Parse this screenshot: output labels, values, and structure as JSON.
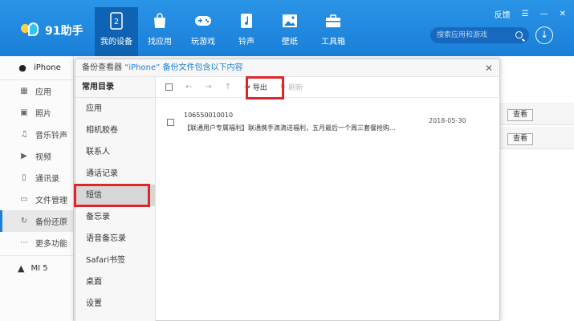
{
  "app": {
    "logo_text": "91助手",
    "window_controls": {
      "feedback": "反馈",
      "menu": "☰",
      "minimize": "—",
      "close": "✕"
    },
    "search": {
      "placeholder": "搜索应用和游戏"
    }
  },
  "nav": [
    {
      "label": "我的设备",
      "icon": "device-icon",
      "active": true
    },
    {
      "label": "找应用",
      "icon": "bag-icon"
    },
    {
      "label": "玩游戏",
      "icon": "gamepad-icon"
    },
    {
      "label": "铃声",
      "icon": "music-note-icon"
    },
    {
      "label": "壁纸",
      "icon": "image-icon"
    },
    {
      "label": "工具箱",
      "icon": "toolbox-icon"
    }
  ],
  "sidebar": {
    "device": "iPhone",
    "items": [
      {
        "label": "应用",
        "icon": "apps-icon"
      },
      {
        "label": "照片",
        "icon": "photo-icon"
      },
      {
        "label": "音乐铃声",
        "icon": "music-icon"
      },
      {
        "label": "视频",
        "icon": "video-icon"
      },
      {
        "label": "通讯录",
        "icon": "contacts-icon"
      },
      {
        "label": "文件管理",
        "icon": "folder-icon"
      },
      {
        "label": "备份还原",
        "icon": "backup-icon",
        "active": true
      },
      {
        "label": "更多功能",
        "icon": "more-icon"
      }
    ],
    "device2": "MI 5"
  },
  "background": {
    "view_labels": [
      "查看",
      "查看"
    ]
  },
  "dialog": {
    "title_prefix": "备份查看器",
    "title_highlight": "“iPhone” 备份文件包含以下内容",
    "close": "✕",
    "category_header": "常用目录",
    "categories": [
      "应用",
      "相机胶卷",
      "联系人",
      "通话记录",
      "短信",
      "备忘录",
      "语音备忘录",
      "Safari书签",
      "桌面",
      "设置"
    ],
    "active_category": "短信",
    "toolbar": {
      "export": "导出",
      "refresh": "刷新"
    },
    "messages": [
      {
        "number": "106550010010",
        "text": "【联通用户专属福利】联通携手滴滴送福利，五月最后一个周三套餐抢购...",
        "date": "2018-05-30"
      }
    ]
  },
  "colors": {
    "topbar": "#1a7fd8",
    "highlight_box": "#e0252a"
  }
}
